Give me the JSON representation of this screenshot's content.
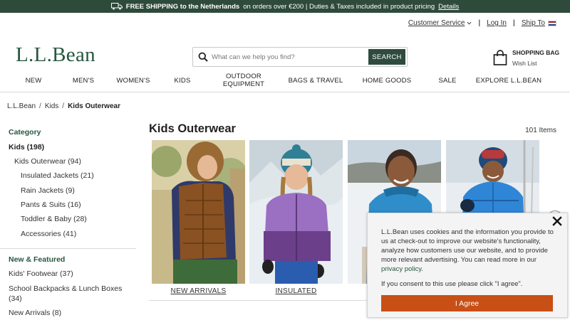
{
  "promo": {
    "bold": "FREE SHIPPING to the Netherlands",
    "text": "on orders over €200 | Duties & Taxes included in product pricing",
    "link": "Details"
  },
  "utility": {
    "customer_service": "Customer Service",
    "login": "Log In",
    "ship_to": "Ship To"
  },
  "logo": "L.L.Bean",
  "search": {
    "placeholder": "What can we help you find?",
    "button": "SEARCH"
  },
  "bag": {
    "title": "SHOPPING BAG",
    "wishlist": "Wish List"
  },
  "nav": [
    "NEW",
    "MEN'S",
    "WOMEN'S",
    "KIDS",
    "OUTDOOR EQUIPMENT",
    "BAGS & TRAVEL",
    "HOME GOODS",
    "SALE",
    "EXPLORE L.L.BEAN"
  ],
  "breadcrumb": {
    "items": [
      "L.L.Bean",
      "Kids"
    ],
    "current": "Kids Outerwear",
    "separator": "/"
  },
  "sidebar": {
    "category_heading": "Category",
    "kids": "Kids (198)",
    "kids_outerwear": "Kids Outerwear (94)",
    "sub": [
      "Insulated Jackets (21)",
      "Rain Jackets (9)",
      "Pants & Suits (16)",
      "Toddler & Baby (28)",
      "Accessories (41)"
    ],
    "new_heading": "New & Featured",
    "featured": [
      "Kids' Footwear (37)",
      "School Backpacks & Lunch Boxes (34)",
      "New Arrivals (8)"
    ]
  },
  "main": {
    "title": "Kids Outerwear",
    "count": "101 Items",
    "tiles": [
      {
        "caption": "NEW ARRIVALS"
      },
      {
        "caption": "INSULATED"
      },
      {
        "caption": ""
      },
      {
        "caption": ""
      }
    ]
  },
  "cookie": {
    "text": "L.L.Bean uses cookies and the information you provide to us at check-out to improve our website's functionality, analyze how customers use our website, and to provide more relevant advertising. You can read more in our",
    "link": "privacy policy",
    "consent": "If you consent to this use please click \"I agree\".",
    "button": "I Agree"
  },
  "colors": {
    "brand_green": "#26563f",
    "promo_bg": "#2e4a3a",
    "agree_orange": "#c84f16"
  }
}
